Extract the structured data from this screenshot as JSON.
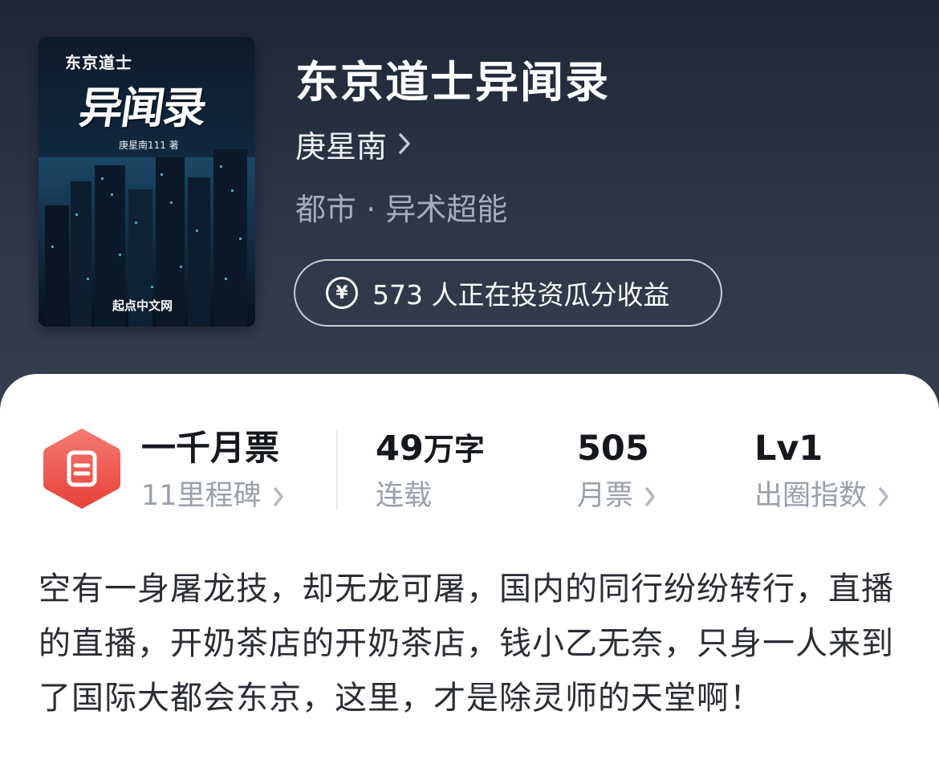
{
  "colors": {
    "header_bg": "#2c3445",
    "card_bg": "#ffffff",
    "badge_red": "#ef5350",
    "muted_text": "#9aa0aa"
  },
  "book": {
    "title": "东京道士异闻录",
    "author": "庚星南",
    "genre": "都市 · 异术超能",
    "invest_label": "573 人正在投资瓜分收益",
    "invest_icon": "yen-coin-icon"
  },
  "cover": {
    "small_title": "东京道士",
    "big_title": "异闻录",
    "author_line": "庚星南111 著",
    "publisher": "起点中文网"
  },
  "stats": {
    "badge_icon": "ticket-badge-icon",
    "honor": {
      "value": "一千月票",
      "label": "11里程碑"
    },
    "words": {
      "number": "49",
      "unit": "万字",
      "label": "连载"
    },
    "monthly": {
      "value": "505",
      "label": "月票"
    },
    "level": {
      "value": "Lv1",
      "label": "出圈指数"
    }
  },
  "synopsis": "空有一身屠龙技，却无龙可屠，国内的同行纷纷转行，直播的直播，开奶茶店的开奶茶店，钱小乙无奈，只身一人来到了国际大都会东京，这里，才是除灵师的天堂啊！"
}
